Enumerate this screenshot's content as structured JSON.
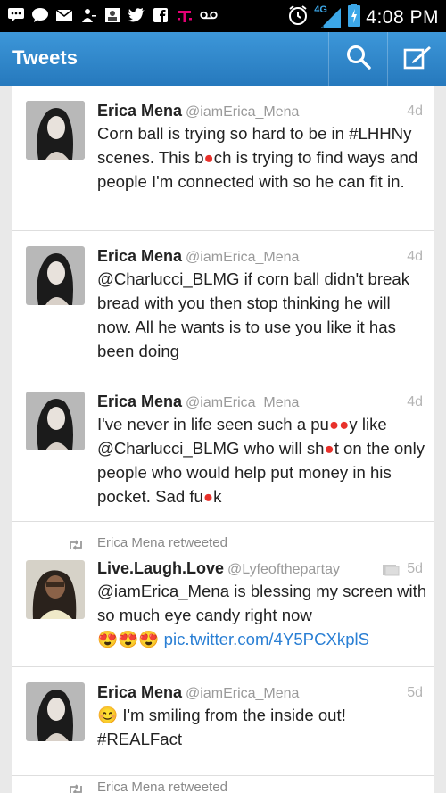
{
  "status_bar": {
    "time": "4:08 PM",
    "network": "4G",
    "left_icons": [
      "chat-icon",
      "message-icon",
      "mail-icon",
      "person-icon",
      "image-icon",
      "twitter-icon",
      "facebook-icon",
      "tmobile-icon",
      "voicemail-icon"
    ],
    "right_icons": [
      "alarm-icon",
      "signal-icon",
      "battery-icon"
    ]
  },
  "action_bar": {
    "title": "Tweets",
    "icons": [
      "search-icon",
      "compose-icon"
    ]
  },
  "tweets": [
    {
      "name": "Erica Mena",
      "handle": "@iamErica_Mena",
      "age": "4d",
      "text": "Corn ball is trying so hard to be in #LHHNy scenes. This b●ch is trying to find ways and people I'm connected with so he can fit in."
    },
    {
      "name": "Erica Mena",
      "handle": "@iamErica_Mena",
      "age": "4d",
      "text": "@Charlucci_BLMG if corn ball didn't break bread with you then stop thinking he will now. All he wants is to use you like it has been doing"
    },
    {
      "name": "Erica Mena",
      "handle": "@iamErica_Mena",
      "age": "4d",
      "text": "I've never in life seen such a pu●●y like @Charlucci_BLMG who will sh●t on the only people who would help put money in his pocket. Sad fu●k"
    },
    {
      "retweeted_by": "Erica Mena retweeted",
      "name": "Live.Laugh.Love",
      "handle": "@Lyfeofthepartay",
      "age": "5d",
      "text": "@iamErica_Mena is blessing my screen with so much eye candy right now",
      "emoji": "😍😍😍",
      "link": "pic.twitter.com/4Y5PCXkplS"
    },
    {
      "name": "Erica Mena",
      "handle": "@iamErica_Mena",
      "age": "5d",
      "emoji": "😊",
      "text": "I'm smiling from the inside out! #REALFact"
    },
    {
      "retweeted_by": "Erica Mena retweeted"
    }
  ],
  "colors": {
    "action_bar": "#2a82c6",
    "link": "#2a7fd4",
    "censor": "#e8312b"
  }
}
